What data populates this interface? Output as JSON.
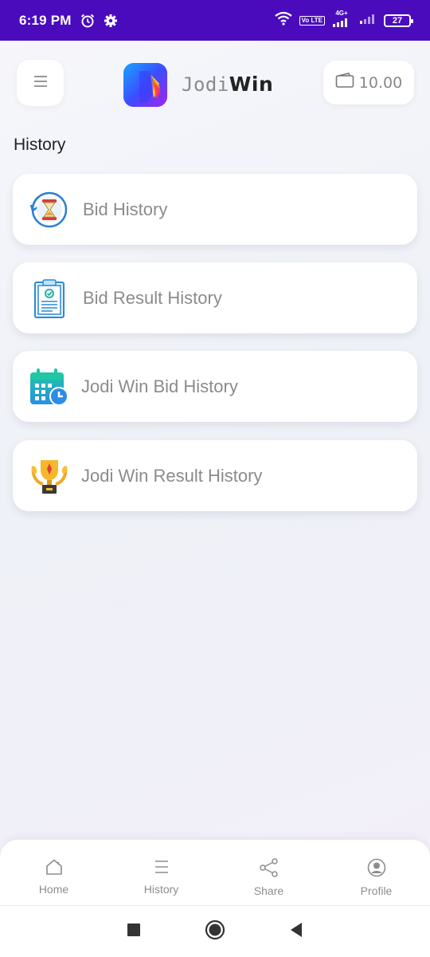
{
  "status_bar": {
    "time": "6:19 PM",
    "network_tag": "4G+",
    "volte": "Vo LTE",
    "battery": "27",
    "icons": [
      "alarm-icon",
      "settings-icon",
      "wifi-icon",
      "signal-icon",
      "battery-icon"
    ]
  },
  "header": {
    "brand_light": "Jodi",
    "brand_bold": "Win",
    "wallet_balance": "10.00"
  },
  "section": {
    "title": "History"
  },
  "items": [
    {
      "label": "Bid History",
      "icon": "hourglass-history-icon"
    },
    {
      "label": "Bid Result History",
      "icon": "clipboard-check-icon"
    },
    {
      "label": "Jodi Win Bid History",
      "icon": "calendar-clock-icon"
    },
    {
      "label": "Jodi Win Result History",
      "icon": "trophy-icon"
    }
  ],
  "bottom_nav": {
    "home": "Home",
    "history": "History",
    "share": "Share",
    "profile": "Profile"
  },
  "colors": {
    "status_bar": "#4a0bbd",
    "card_bg": "#ffffff",
    "label_gray": "#8b8b8b"
  }
}
